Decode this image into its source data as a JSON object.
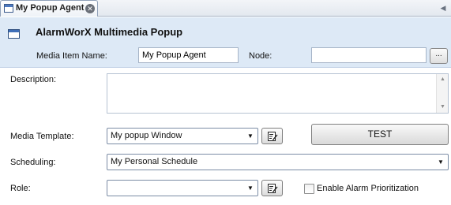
{
  "tab": {
    "label": "My Popup Agent",
    "close_glyph": "✕",
    "icon": "window-icon",
    "scroll_glyph": "◀"
  },
  "header": {
    "title": "AlarmWorX Multimedia Popup",
    "icon": "window-icon",
    "background": "#dde9f6"
  },
  "media_item": {
    "label": "Media Item Name:",
    "value": "My Popup Agent"
  },
  "node": {
    "label": "Node:",
    "value": "",
    "browse_label": "..."
  },
  "description": {
    "label": "Description:",
    "value": "",
    "scroll_up": "▲",
    "scroll_down": "▼"
  },
  "media_template": {
    "label": "Media Template:",
    "selected": "My popup Window",
    "arrow": "▼",
    "edit_icon": "edit-icon"
  },
  "test_button": {
    "label": "TEST"
  },
  "scheduling": {
    "label": "Scheduling:",
    "selected": "My Personal Schedule",
    "arrow": "▼"
  },
  "role": {
    "label": "Role:",
    "selected": "",
    "arrow": "▼",
    "edit_icon": "edit-icon"
  },
  "prioritization": {
    "label": "Enable Alarm Prioritization",
    "checked": false
  }
}
